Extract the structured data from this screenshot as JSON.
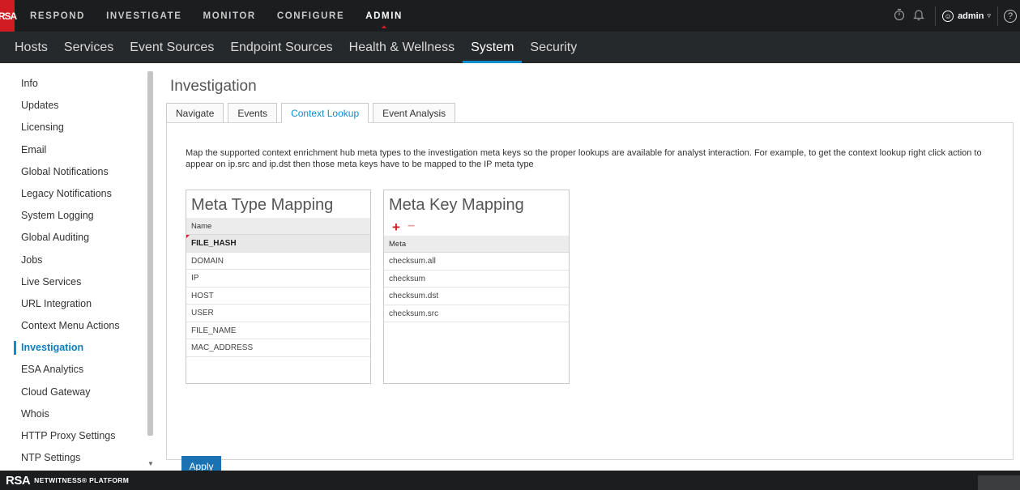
{
  "brand": {
    "logo": "RSA",
    "footer_logo": "RSA",
    "footer_text": "NETWITNESS® PLATFORM"
  },
  "topnav": [
    {
      "label": "RESPOND"
    },
    {
      "label": "INVESTIGATE"
    },
    {
      "label": "MONITOR"
    },
    {
      "label": "CONFIGURE"
    },
    {
      "label": "ADMIN",
      "active": true
    }
  ],
  "topright": {
    "timer_icon": "stopwatch-icon",
    "bell_icon": "bell-icon",
    "user_label": "admin",
    "help_label": "?"
  },
  "secnav": [
    {
      "label": "Hosts"
    },
    {
      "label": "Services"
    },
    {
      "label": "Event Sources"
    },
    {
      "label": "Endpoint Sources"
    },
    {
      "label": "Health & Wellness"
    },
    {
      "label": "System",
      "active": true
    },
    {
      "label": "Security"
    }
  ],
  "sidebar": {
    "items": [
      {
        "label": "Info"
      },
      {
        "label": "Updates"
      },
      {
        "label": "Licensing"
      },
      {
        "label": "Email"
      },
      {
        "label": "Global Notifications"
      },
      {
        "label": "Legacy Notifications"
      },
      {
        "label": "System Logging"
      },
      {
        "label": "Global Auditing"
      },
      {
        "label": "Jobs"
      },
      {
        "label": "Live Services"
      },
      {
        "label": "URL Integration"
      },
      {
        "label": "Context Menu Actions"
      },
      {
        "label": "Investigation",
        "active": true
      },
      {
        "label": "ESA Analytics"
      },
      {
        "label": "Cloud Gateway"
      },
      {
        "label": "Whois"
      },
      {
        "label": "HTTP Proxy Settings"
      },
      {
        "label": "NTP Settings"
      }
    ]
  },
  "main": {
    "title": "Investigation",
    "tabs": [
      {
        "label": "Navigate"
      },
      {
        "label": "Events"
      },
      {
        "label": "Context Lookup",
        "active": true
      },
      {
        "label": "Event Analysis"
      }
    ],
    "description": "Map the supported context enrichment hub meta types to the investigation meta keys so the proper lookups are available for analyst interaction. For example, to get the context lookup right click action to appear on ip.src and ip.dst then those meta keys have to be mapped to the IP meta type",
    "meta_type": {
      "title": "Meta Type Mapping",
      "column": "Name",
      "rows": [
        "FILE_HASH",
        "DOMAIN",
        "IP",
        "HOST",
        "USER",
        "FILE_NAME",
        "MAC_ADDRESS"
      ],
      "selected": "FILE_HASH"
    },
    "meta_key": {
      "title": "Meta Key Mapping",
      "add_label": "+",
      "remove_label": "−",
      "column": "Meta",
      "rows": [
        "checksum.all",
        "checksum",
        "checksum.dst",
        "checksum.src"
      ]
    },
    "apply_label": "Apply"
  },
  "colors": {
    "accent": "#0c8dd0",
    "brand_red": "#d11c24",
    "apply_bg": "#1a72b3"
  }
}
